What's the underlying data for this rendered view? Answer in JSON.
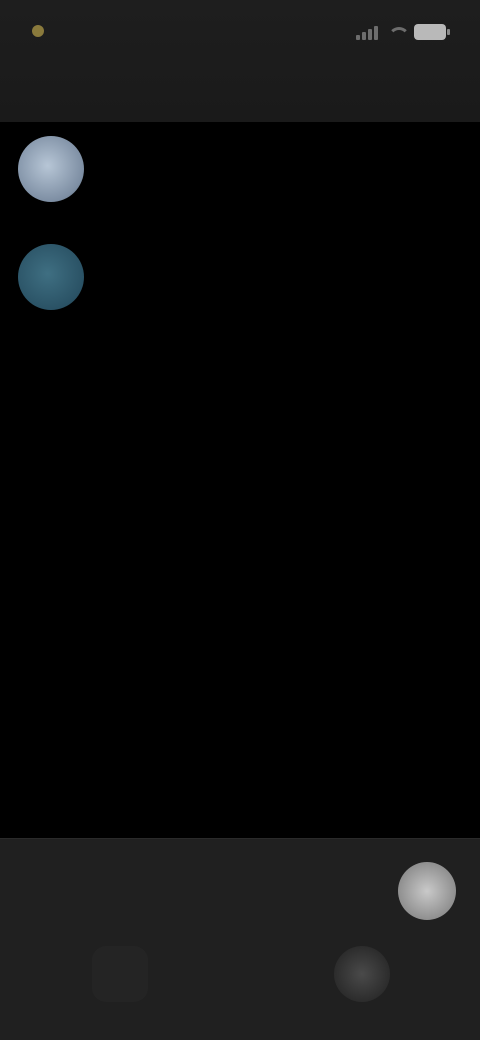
{
  "status_bar": {
    "time": "",
    "colors": {
      "time_dot": "#8a7a3c",
      "battery": "#b9b9b9"
    },
    "icons": [
      "signal-icon",
      "wifi-icon",
      "battery-icon"
    ]
  },
  "header": {
    "title": ""
  },
  "chats": [
    {
      "name": "",
      "tag": "",
      "preview": "",
      "meta": "",
      "avatar_color": "#9fb0c4"
    },
    {
      "name": "",
      "tag": "",
      "preview": "",
      "meta": "",
      "avatar_color": "#2f5c6e"
    }
  ],
  "bottom": {
    "composer_hint": "",
    "fab_icon": "compose-icon",
    "nav": [
      "home-nav-icon",
      "profile-nav-icon"
    ]
  }
}
